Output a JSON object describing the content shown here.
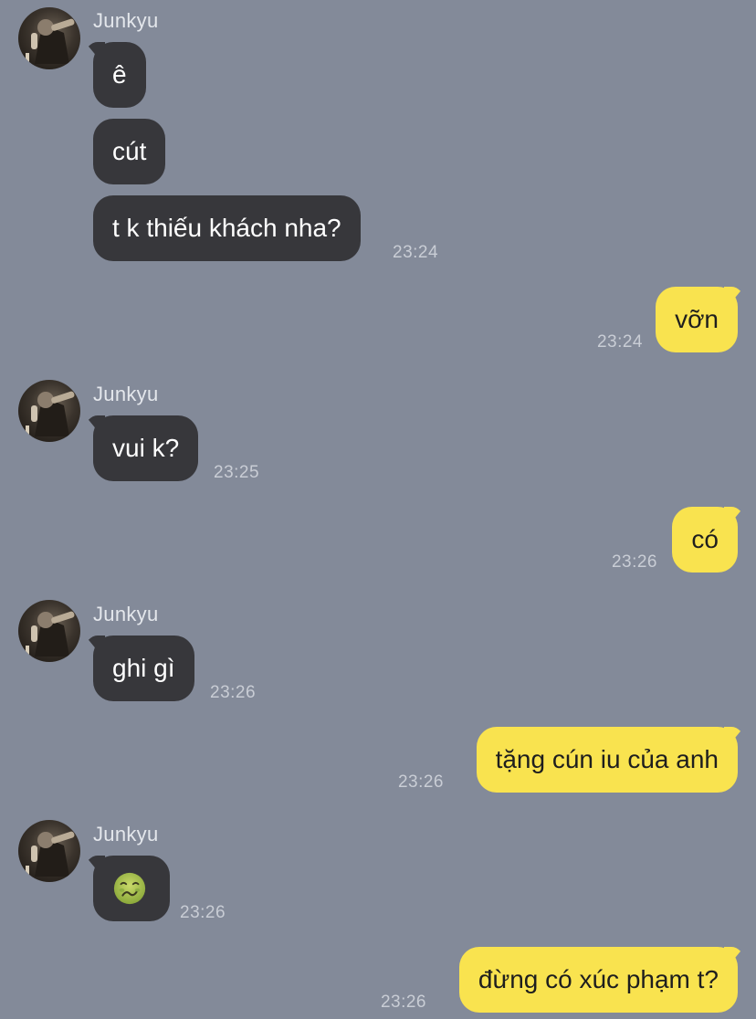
{
  "contact": {
    "name": "Junkyu"
  },
  "colors": {
    "background": "#838A99",
    "incoming_bubble": "#37373B",
    "outgoing_bubble": "#F9E34F",
    "timestamp": "#C9CDD5"
  },
  "messages": [
    {
      "direction": "in",
      "text": "ê"
    },
    {
      "direction": "in",
      "text": "cút"
    },
    {
      "direction": "in",
      "text": "t k thiếu khách nha?",
      "time": "23:24"
    },
    {
      "direction": "out",
      "text": "vỡn",
      "time": "23:24"
    },
    {
      "direction": "in",
      "text": "vui k?",
      "time": "23:25"
    },
    {
      "direction": "out",
      "text": "có",
      "time": "23:26"
    },
    {
      "direction": "in",
      "text": "ghi gì",
      "time": "23:26"
    },
    {
      "direction": "out",
      "text": "tặng cún iu của anh",
      "time": "23:26"
    },
    {
      "direction": "in",
      "emoji": "nauseated-face-icon",
      "time": "23:26"
    },
    {
      "direction": "out",
      "text": "đừng có xúc phạm t?",
      "time": "23:26"
    }
  ]
}
